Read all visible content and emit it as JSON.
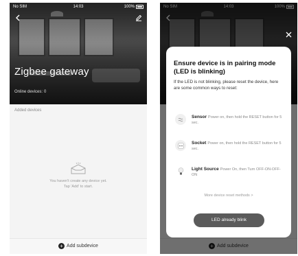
{
  "status_bar": {
    "carrier": "No SIM",
    "time": "14:03",
    "battery": "100%"
  },
  "gateway": {
    "title": "Zigbee gateway",
    "online_label": "Online devices:",
    "online_count": "0"
  },
  "list": {
    "section_label": "Added devices",
    "empty_line1": "You haven't create any device yet.",
    "empty_line2": "Tap 'Add' to start."
  },
  "bottom": {
    "add_label": "Add subdevice"
  },
  "modal": {
    "title": "Ensure device is in pairing mode (LED is blinking)",
    "description": "If the LED is not blinking, please reset the device, here are some common ways to reset:",
    "methods": [
      {
        "name": "Sensor",
        "text": "Power on, then hold the RESET button for 5 sec.",
        "icon": "sensor-icon"
      },
      {
        "name": "Socket",
        "text": "Power on, then hold the RESET button for 5 sec.",
        "icon": "socket-icon"
      },
      {
        "name": "Light Source",
        "text": "Power On, then Turn OFF-ON-OFF-ON",
        "icon": "bulb-icon"
      }
    ],
    "more_link": "More device reset methods >",
    "confirm_label": "LED already blink"
  },
  "colors": {
    "accent_button": "#5b5b5b",
    "overlay": "rgba(0,0,0,0.55)"
  }
}
